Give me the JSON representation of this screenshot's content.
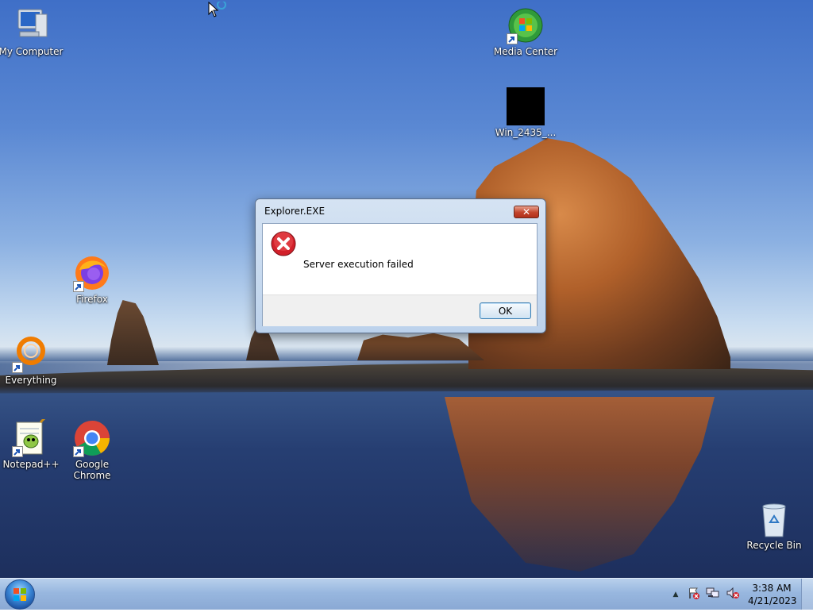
{
  "desktop": {
    "icons": [
      {
        "id": "my-computer",
        "label": "My Computer"
      },
      {
        "id": "media-center",
        "label": "Media Center"
      },
      {
        "id": "win-file",
        "label": "Win_2435_..."
      },
      {
        "id": "firefox",
        "label": "Firefox"
      },
      {
        "id": "everything",
        "label": "Everything"
      },
      {
        "id": "notepadpp",
        "label": "Notepad++"
      },
      {
        "id": "chrome",
        "label": "Google Chrome"
      },
      {
        "id": "recycle-bin",
        "label": "Recycle Bin"
      }
    ]
  },
  "dialog": {
    "title": "Explorer.EXE",
    "close_label": "✕",
    "message": "Server execution failed",
    "ok_label": "OK"
  },
  "taskbar": {
    "tray_icons": [
      "show-hidden-icons-arrow-icon",
      "action-center-flag-icon",
      "network-icon",
      "volume-muted-icon"
    ],
    "time": "3:38 AM",
    "date": "4/21/2023"
  },
  "colors": {
    "dialog_close": "#c2432b",
    "ok_border": "#3c7fb1",
    "taskbar": "#98b7df"
  }
}
